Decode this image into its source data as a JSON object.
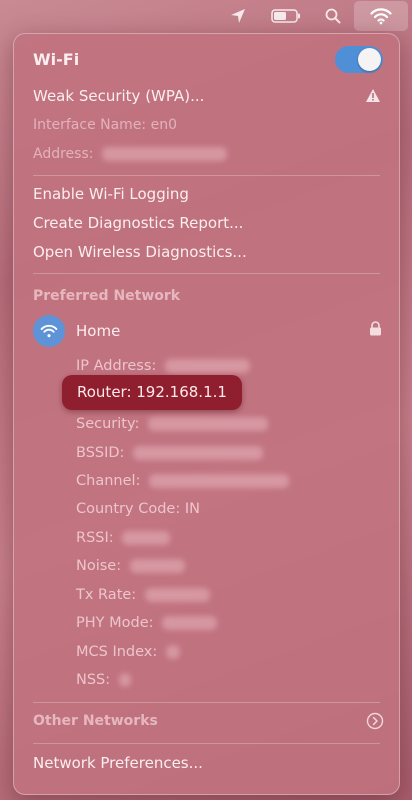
{
  "menubar": {
    "location_icon": "location-arrow-icon",
    "battery_icon": "battery-icon",
    "search_icon": "search-icon",
    "wifi_icon": "wifi-icon"
  },
  "panel": {
    "title": "Wi-Fi",
    "toggle_on": true,
    "security_warning": "Weak Security (WPA)...",
    "interface_name": "Interface Name: en0",
    "address_label": "Address: ",
    "menu": {
      "enable_logging": "Enable Wi-Fi Logging",
      "create_report": "Create Diagnostics Report...",
      "open_diagnostics": "Open Wireless Diagnostics..."
    },
    "preferred_header": "Preferred Network",
    "network": {
      "name": "Home",
      "details": {
        "ip_label": "IP Address: ",
        "router": "Router: 192.168.1.1",
        "security_label": "Security: ",
        "bssid_label": "BSSID: ",
        "channel_label": "Channel: ",
        "country": "Country Code: IN",
        "rssi_label": "RSSI: ",
        "noise_label": "Noise: ",
        "tx_label": "Tx Rate: ",
        "phy_label": "PHY Mode: ",
        "mcs_label": "MCS Index: ",
        "nss_label": "NSS: "
      }
    },
    "other_networks": "Other Networks",
    "network_prefs": "Network Preferences..."
  },
  "colors": {
    "accent": "#4f8fd6",
    "highlight": "#8f1f2e",
    "panel": "#c0727e"
  }
}
